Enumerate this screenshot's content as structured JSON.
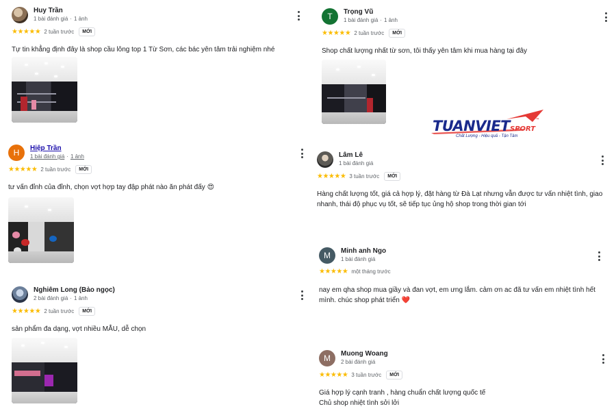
{
  "colors": {
    "star": "#fbbc04",
    "name_link": "#1a0dab",
    "meta": "#5f6368",
    "logo_blue": "#1a2a8c",
    "logo_red": "#e53935"
  },
  "logo": {
    "brand": "TUANVIET",
    "suffix": "SPORT",
    "tm": "™",
    "tagline": "Chất Lượng - Hiệu quả - Tận Tâm"
  },
  "reviews": {
    "r1": {
      "avatar": "photo",
      "name": "Huy Trần",
      "count": "1 bài đánh giá",
      "photos": "1 ảnh",
      "stars": "★★★★★",
      "time": "2 tuần trước",
      "badge": "MỚI",
      "text": "Tự tin khẳng định đây là shop cầu lông top 1 Từ Sơn, các bác yên tâm trải nghiệm nhé"
    },
    "r2": {
      "avatar": "H",
      "avatar_color": "#e8710a",
      "name": "Hiệp Trần",
      "count": "1 bài đánh giá",
      "photos": "1 ảnh",
      "stars": "★★★★★",
      "time": "2 tuần trước",
      "badge": "MỚI",
      "text": "tư vấn đỉnh của đỉnh, chọn vợt hợp tay đập phát nào ăn phát đấy 😍"
    },
    "r3": {
      "avatar": "photo",
      "name": "Nghiêm Long (Bảo ngọc)",
      "count": "2 bài đánh giá",
      "photos": "1 ảnh",
      "stars": "★★★★★",
      "time": "2 tuần trước",
      "badge": "MỚI",
      "text": "sản phẩm đa dạng, vợt nhiều MẪU, dễ chọn"
    },
    "r4": {
      "avatar": "T",
      "avatar_color": "#137333",
      "name": "Trọng Vũ",
      "count": "1 bài đánh giá",
      "photos": "1 ảnh",
      "stars": "★★★★★",
      "time": "2 tuần trước",
      "badge": "MỚI",
      "text": "Shop chất lượng nhất từ sơn, tôi thấy yên tâm khi mua hàng tại đây"
    },
    "r5": {
      "avatar": "photo",
      "name": "Lâm Lê",
      "count": "1 bài đánh giá",
      "stars": "★★★★★",
      "time": "3 tuần trước",
      "badge": "MỚI",
      "text": "Hàng chất lượng tốt, giá cả hợp lý, đặt hàng từ Đà Lạt nhưng vẫn được tư vấn nhiệt tình, giao nhanh, thái độ phục vụ tốt, sẽ tiếp tục ủng hộ shop trong thời gian tới"
    },
    "r6": {
      "avatar": "M",
      "avatar_color": "#455a64",
      "name": "Minh anh Ngo",
      "count": "1 bài đánh giá",
      "stars": "★★★★★",
      "time": "một tháng trước",
      "text": "nay em qha shop mua giầy và đan vợt, em ưng lắm. cảm ơn ac đã tư vấn em nhiệt tình hết mình. chúc shop phát triển ❤️"
    },
    "r7": {
      "avatar": "M",
      "avatar_color": "#8d6e63",
      "name": "Muong Woang",
      "count": "2 bài đánh giá",
      "stars": "★★★★★",
      "time": "3 tuần trước",
      "badge": "MỚI",
      "text_line1": "Giá hợp lý cạnh tranh , hàng chuẩn chất lượng quốc tế",
      "text_line2": "Chủ shop nhiệt tình sởi lởi"
    }
  }
}
